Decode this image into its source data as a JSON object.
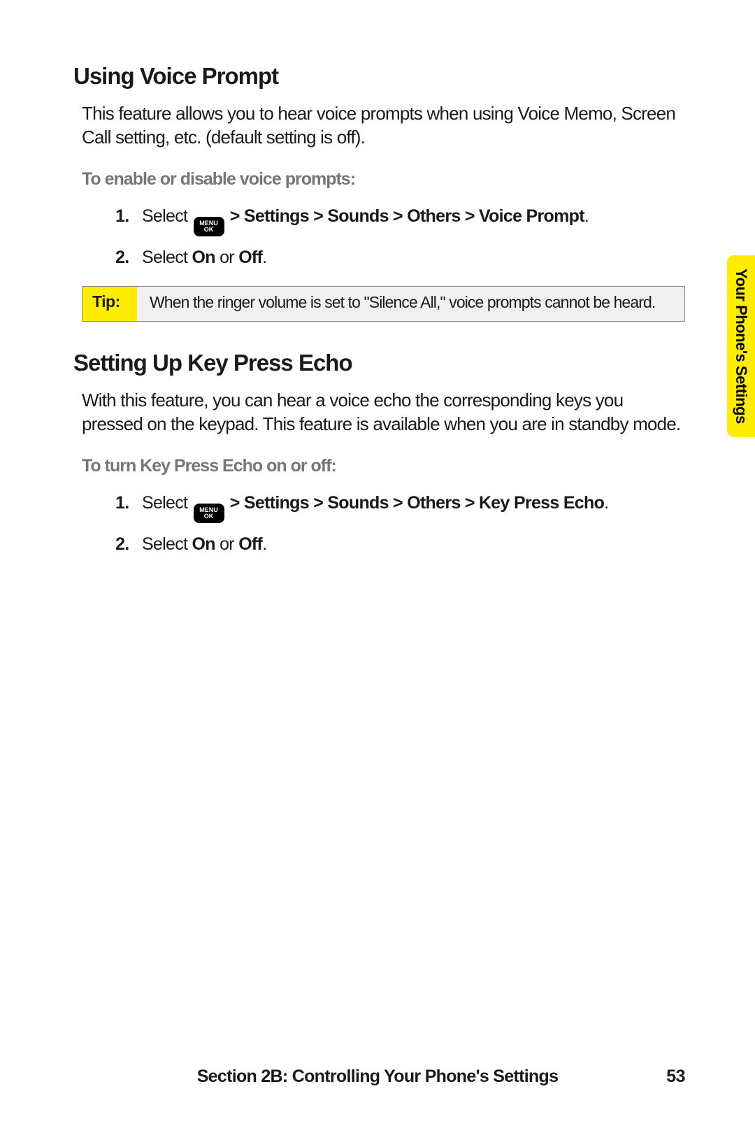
{
  "side_tab": "Your Phone's Settings",
  "section1": {
    "title": "Using Voice Prompt",
    "body": "This feature allows you to hear voice prompts when using Voice Memo, Screen Call setting, etc. (default setting is off).",
    "subhead": "To enable or disable voice prompts:",
    "steps": [
      {
        "num": "1.",
        "pre": "Select ",
        "menu_top": "MENU",
        "menu_bot": "OK",
        "path": " > Settings > Sounds > Others > Voice Prompt",
        "post": "."
      },
      {
        "num": "2.",
        "pre": "Select ",
        "b1": "On",
        "mid": " or ",
        "b2": "Off",
        "post": "."
      }
    ]
  },
  "tip": {
    "label": "Tip:",
    "text": "When the ringer volume is set to \"Silence All,\" voice prompts cannot be heard."
  },
  "section2": {
    "title": "Setting Up Key Press Echo",
    "body": "With this feature, you can hear a voice echo the corresponding keys you pressed on the keypad. This feature is available when you are in standby mode.",
    "subhead": "To turn Key Press Echo on or off:",
    "steps": [
      {
        "num": "1.",
        "pre": "Select ",
        "menu_top": "MENU",
        "menu_bot": "OK",
        "path": " > Settings > Sounds > Others > Key Press Echo",
        "post": "."
      },
      {
        "num": "2.",
        "pre": "Select ",
        "b1": "On",
        "mid": " or ",
        "b2": "Off",
        "post": "."
      }
    ]
  },
  "footer": {
    "text": "Section 2B: Controlling Your Phone's Settings",
    "page": "53"
  }
}
